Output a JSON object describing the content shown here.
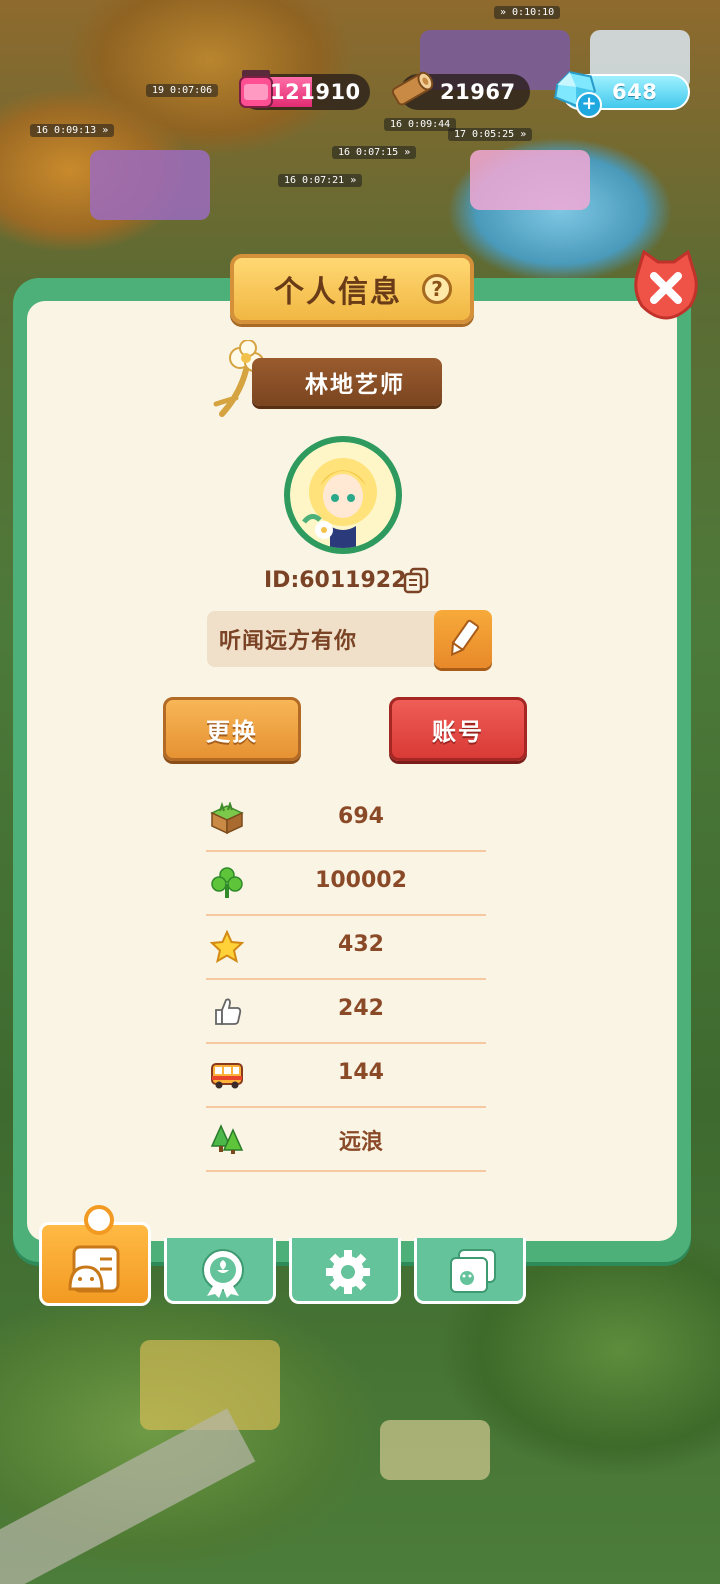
{
  "resources": {
    "gel": "121910",
    "wood": "21967",
    "gems": "648"
  },
  "panel": {
    "title": "个人信息",
    "help_glyph": "?",
    "player_title": "林地艺师",
    "player_id": "ID:6011922",
    "signature": "听闻远方有你"
  },
  "buttons": {
    "change": "更换",
    "account": "账号"
  },
  "stats": [
    {
      "icon": "grass-block-icon",
      "value": "694"
    },
    {
      "icon": "clover-icon",
      "value": "100002"
    },
    {
      "icon": "star-icon",
      "value": "432"
    },
    {
      "icon": "thumbs-up-icon",
      "value": "242"
    },
    {
      "icon": "bus-icon",
      "value": "144"
    },
    {
      "icon": "trees-icon",
      "value": "远浪"
    }
  ],
  "tabs": [
    {
      "name": "profile-card",
      "active": true
    },
    {
      "name": "badge-rosette",
      "active": false
    },
    {
      "name": "settings-gear",
      "active": false
    },
    {
      "name": "album-photos",
      "active": false
    }
  ]
}
